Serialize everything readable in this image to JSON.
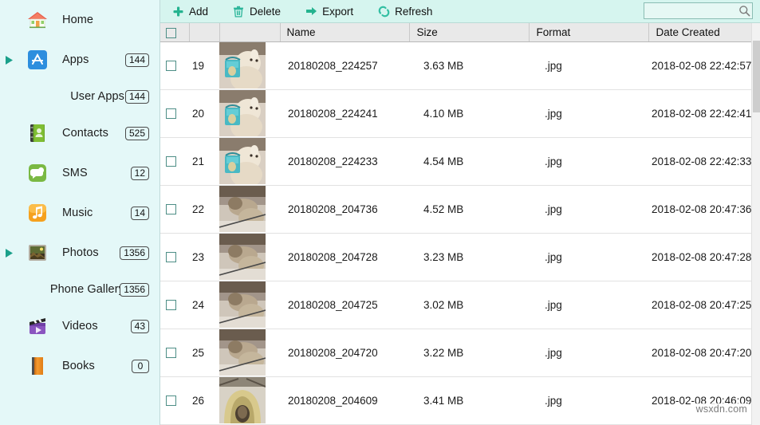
{
  "sidebar": {
    "background_color": "#e4f8f8",
    "items": [
      {
        "label": "Home",
        "icon": "house-icon",
        "badge": "",
        "expandable": false,
        "sub": false
      },
      {
        "label": "Apps",
        "icon": "app-store-icon",
        "badge": "144",
        "expandable": true,
        "sub": false
      },
      {
        "label": "User Apps",
        "icon": "",
        "badge": "144",
        "expandable": false,
        "sub": true
      },
      {
        "label": "Contacts",
        "icon": "address-book-icon",
        "badge": "525",
        "expandable": false,
        "sub": false
      },
      {
        "label": "SMS",
        "icon": "speech-bubble-icon",
        "badge": "12",
        "expandable": false,
        "sub": false
      },
      {
        "label": "Music",
        "icon": "music-note-icon",
        "badge": "14",
        "expandable": false,
        "sub": false
      },
      {
        "label": "Photos",
        "icon": "picture-frame-icon",
        "badge": "1356",
        "expandable": true,
        "sub": false
      },
      {
        "label": "Phone Gallery",
        "icon": "",
        "badge": "1356",
        "expandable": false,
        "sub": true
      },
      {
        "label": "Videos",
        "icon": "clapperboard-icon",
        "badge": "43",
        "expandable": false,
        "sub": false
      },
      {
        "label": "Books",
        "icon": "book-icon",
        "badge": "0",
        "expandable": false,
        "sub": false
      }
    ]
  },
  "toolbar": {
    "background_color": "#d6f5ef",
    "accent_color": "#2bb59a",
    "buttons": [
      {
        "label": "Add",
        "icon": "plus-icon"
      },
      {
        "label": "Delete",
        "icon": "trash-icon"
      },
      {
        "label": "Export",
        "icon": "arrow-right-icon"
      },
      {
        "label": "Refresh",
        "icon": "refresh-icon"
      }
    ],
    "search": {
      "value": "",
      "placeholder": "",
      "icon": "search-icon"
    }
  },
  "table": {
    "columns": [
      "",
      "",
      "",
      "Name",
      "Size",
      "Format",
      "Date Created"
    ],
    "headers": {
      "name": "Name",
      "size": "Size",
      "format": "Format",
      "date_created": "Date Created"
    },
    "rows": [
      {
        "index": "19",
        "name": "20180208_224257",
        "size": "3.63 MB",
        "format": ".jpg",
        "date": "2018-02-08 22:42:57",
        "checked": false,
        "thumb": "dog-with-bag-photo"
      },
      {
        "index": "20",
        "name": "20180208_224241",
        "size": "4.10 MB",
        "format": ".jpg",
        "date": "2018-02-08 22:42:41",
        "checked": false,
        "thumb": "dog-with-bag-photo"
      },
      {
        "index": "21",
        "name": "20180208_224233",
        "size": "4.54 MB",
        "format": ".jpg",
        "date": "2018-02-08 22:42:33",
        "checked": false,
        "thumb": "dog-with-bag-photo"
      },
      {
        "index": "22",
        "name": "20180208_204736",
        "size": "4.52 MB",
        "format": ".jpg",
        "date": "2018-02-08 20:47:36",
        "checked": false,
        "thumb": "dog-on-leash-photo"
      },
      {
        "index": "23",
        "name": "20180208_204728",
        "size": "3.23 MB",
        "format": ".jpg",
        "date": "2018-02-08 20:47:28",
        "checked": false,
        "thumb": "dog-on-leash-photo"
      },
      {
        "index": "24",
        "name": "20180208_204725",
        "size": "3.02 MB",
        "format": ".jpg",
        "date": "2018-02-08 20:47:25",
        "checked": false,
        "thumb": "dog-on-leash-photo"
      },
      {
        "index": "25",
        "name": "20180208_204720",
        "size": "3.22 MB",
        "format": ".jpg",
        "date": "2018-02-08 20:47:20",
        "checked": false,
        "thumb": "dog-on-leash-photo"
      },
      {
        "index": "26",
        "name": "20180208_204609",
        "size": "3.41 MB",
        "format": ".jpg",
        "date": "2018-02-08 20:46:09",
        "checked": false,
        "thumb": "dog-in-tunnel-photo"
      }
    ]
  },
  "watermark": {
    "text": "wsxdn.com"
  }
}
